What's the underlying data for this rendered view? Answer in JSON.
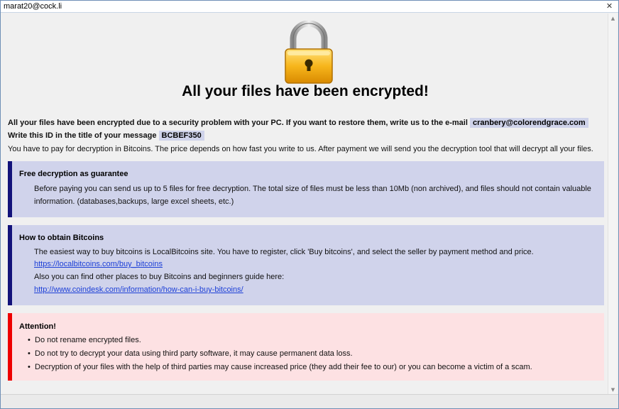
{
  "window": {
    "title": "marat20@cock.li",
    "close_glyph": "✕"
  },
  "icons": {
    "padlock": "padlock-icon",
    "close": "close-icon"
  },
  "colors": {
    "accent_blue": "#12127a",
    "accent_red": "#ee0000",
    "blue_box": "#d0d3eb",
    "red_box": "#fde1e3",
    "link": "#1c3fd7"
  },
  "headline": "All your files have been encrypted!",
  "intro": {
    "line1_text": "All your files have been encrypted due to a security problem with your PC. If you want to restore them, write us to the e-mail",
    "email": "cranbery@colorendgrace.com",
    "line2_text": "Write this ID in the title of your message",
    "id": "BCBEF350",
    "line3_text": "You have to pay for decryption in Bitcoins. The price depends on how fast you write to us. After payment we will send you the decryption tool that will decrypt all your files."
  },
  "free_decryption": {
    "title": "Free decryption as guarantee",
    "line1": "Before paying you can send us up to 5 files for free decryption. The total size of files must be less than 10Mb (non archived), and files should not contain valuable",
    "line2": "information. (databases,backups, large excel sheets, etc.)"
  },
  "bitcoins": {
    "title": "How to obtain Bitcoins",
    "line1": "The easiest way to buy bitcoins is LocalBitcoins site. You have to register, click 'Buy bitcoins', and select the seller by payment method and price.",
    "link1": "https://localbitcoins.com/buy_bitcoins",
    "line2": "Also you can find other places to buy Bitcoins and beginners guide here:",
    "link2": "http://www.coindesk.com/information/how-can-i-buy-bitcoins/"
  },
  "attention": {
    "title": "Attention!",
    "items": [
      "Do not rename encrypted files.",
      "Do not try to decrypt your data using third party software, it may cause permanent data loss.",
      "Decryption of your files with the help of third parties may cause increased price (they add their fee to our) or you can become a victim of a scam."
    ]
  }
}
